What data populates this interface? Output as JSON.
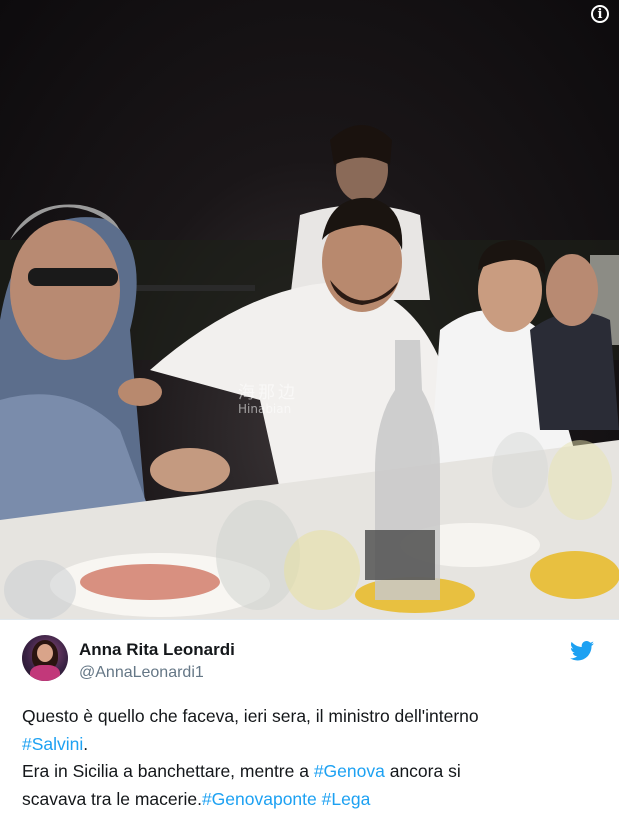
{
  "photo": {
    "alt_icon": "info-icon",
    "watermark_cn": "海那边",
    "watermark_en": "Hinabian"
  },
  "tweet": {
    "author_name": "Anna Rita Leonardi",
    "author_handle": "@AnnaLeonardi1",
    "avatar_icon": "profile-avatar",
    "brand_icon": "twitter-bird-icon",
    "brand_color": "#1da1f2",
    "text_line1": "Questo è quello che faceva, ieri sera, il ministro dell'interno",
    "hashtag_salvini": "#Salvini",
    "text_line2_after": ".",
    "text_line3_before": "Era in Sicilia a banchettare, mentre a ",
    "hashtag_genova": "#Genova",
    "text_line3_after": " ancora si",
    "text_line4_before": "scavava tra le macerie.",
    "hashtag_genovaponte": "#Genovaponte",
    "hashtag_lega": "#Lega"
  }
}
